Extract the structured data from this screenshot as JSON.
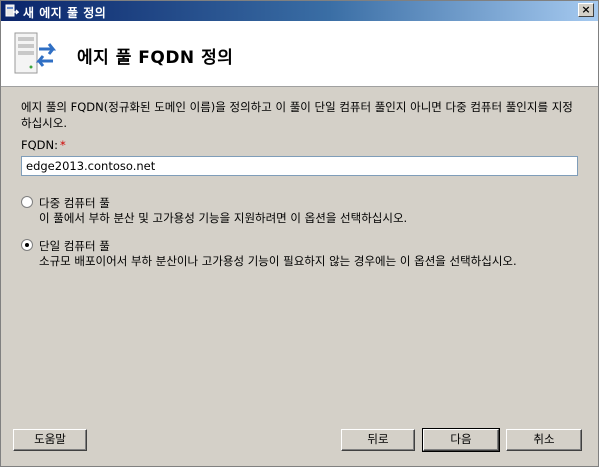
{
  "window": {
    "title": "새 에지 풀 정의",
    "close_glyph": "×"
  },
  "header": {
    "title": "에지 풀 FQDN 정의",
    "icon": "pool-server-icon"
  },
  "intro": {
    "text": "에지 풀의 FQDN(정규화된 도메인 이름)을 정의하고 이 풀이 단일 컴퓨터 풀인지 아니면 다중 컴퓨터 풀인지를 지정하십시오."
  },
  "fqdn": {
    "label": "FQDN:",
    "required_mark": "*",
    "value": "edge2013.contoso.net"
  },
  "options": [
    {
      "label": "다중 컴퓨터 풀",
      "description": "이 풀에서 부하 분산 및 고가용성 기능을 지원하려면 이 옵션을 선택하십시오.",
      "selected": false
    },
    {
      "label": "단일 컴퓨터 풀",
      "description": "소규모 배포이어서 부하 분산이나 고가용성 기능이 필요하지 않는 경우에는 이 옵션을 선택하십시오.",
      "selected": true
    }
  ],
  "buttons": {
    "help": "도움말",
    "back": "뒤로",
    "next": "다음",
    "cancel": "취소"
  },
  "colors": {
    "titlebar_start": "#0a246a",
    "titlebar_end": "#a6caf0",
    "dialog_bg": "#d4d0c8",
    "required": "#d00000"
  }
}
